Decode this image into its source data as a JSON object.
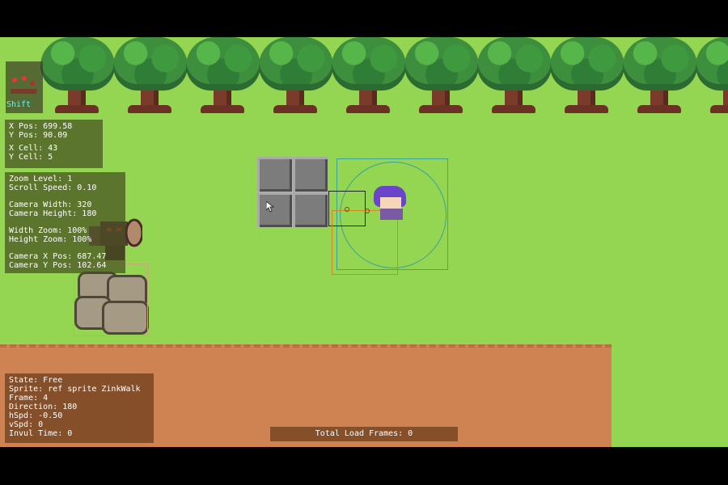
{
  "hud": {
    "shift_label": "Shift",
    "position": {
      "x_pos": "X Pos: 699.58",
      "y_pos": "Y Pos: 90.09",
      "x_cell": "X Cell: 43",
      "y_cell": "Y Cell: 5"
    },
    "camera": {
      "zoom_level": "Zoom Level: 1",
      "scroll_speed": "Scroll Speed: 0.10",
      "camera_width": "Camera Width: 320",
      "camera_height": "Camera Height: 180",
      "width_zoom": "Width Zoom: 100%",
      "height_zoom": "Height Zoom: 100%",
      "camera_x": "Camera X Pos: 687.47",
      "camera_y": "Camera Y Pos: 102.64"
    },
    "state": {
      "state": "State: Free",
      "sprite": "Sprite: ref sprite ZinkWalk",
      "frame": "Frame: 4",
      "direction": "Direction: 180",
      "hspd": "hSpd: -0.50",
      "vspd": "vSpd: 0",
      "invul": "Invul Time: 0"
    },
    "load": "Total Load Frames: 0"
  },
  "colors": {
    "grass": "#94d552",
    "dirt": "#cf8352",
    "hitbox_teal": "#3aa39c",
    "hitbox_orange": "#d4861c",
    "hitbox_tan": "#c8a87a"
  },
  "icons": [
    "tree-icon",
    "character-icon",
    "boulder-icon",
    "enemy-icon",
    "cursor-icon"
  ]
}
